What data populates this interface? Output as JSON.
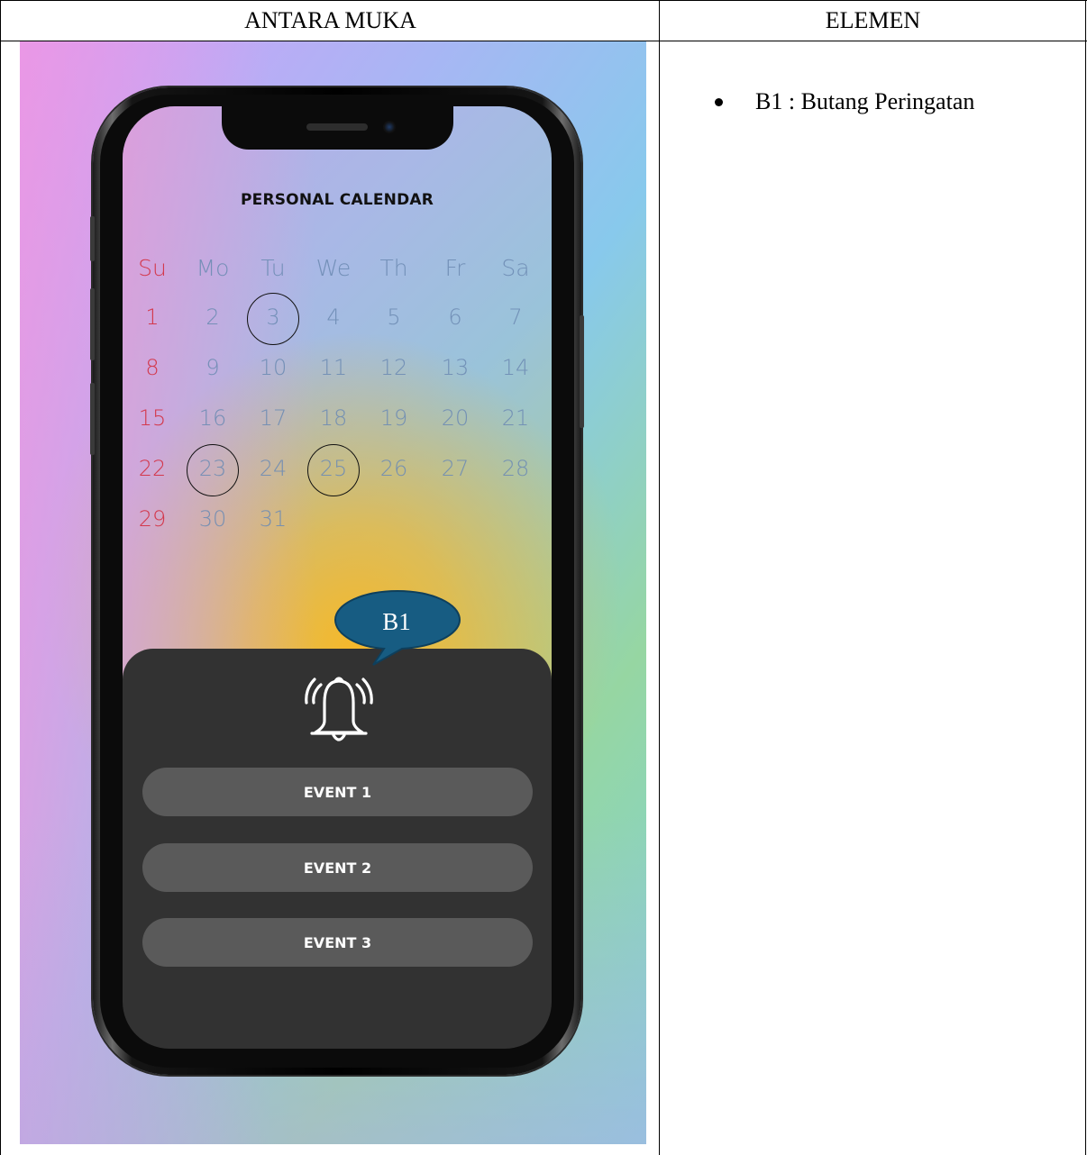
{
  "table": {
    "headers": [
      "ANTARA MUKA",
      "ELEMEN"
    ]
  },
  "elements": [
    "B1 : Butang Peringatan"
  ],
  "calendar": {
    "title": "PERSONAL CALENDAR",
    "weekdays": [
      "Su",
      "Mo",
      "Tu",
      "We",
      "Th",
      "Fr",
      "Sa"
    ],
    "weeks": [
      [
        "1",
        "2",
        "3",
        "4",
        "5",
        "6",
        "7"
      ],
      [
        "8",
        "9",
        "10",
        "11",
        "12",
        "13",
        "14"
      ],
      [
        "15",
        "16",
        "17",
        "18",
        "19",
        "20",
        "21"
      ],
      [
        "22",
        "23",
        "24",
        "25",
        "26",
        "27",
        "28"
      ],
      [
        "29",
        "30",
        "31",
        "",
        "",
        "",
        ""
      ]
    ],
    "highlighted_days": [
      "3",
      "23",
      "25"
    ],
    "sunday_color": "#d3394d"
  },
  "alert": {
    "icon": "bell-ringing-icon",
    "events": [
      "EVENT 1",
      "EVENT 2",
      "EVENT 3"
    ]
  },
  "callout": {
    "label": "B1",
    "color": "#175c82"
  }
}
